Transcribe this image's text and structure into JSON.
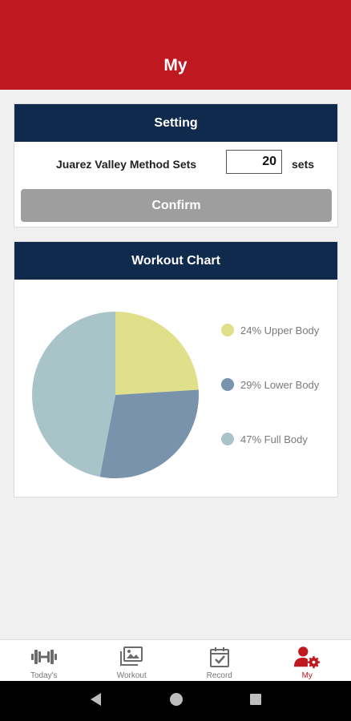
{
  "app_bar": {
    "title": "My",
    "color": "#c01820"
  },
  "setting": {
    "header": "Setting",
    "label": "Juarez Valley Method Sets",
    "value": "20",
    "unit": "sets",
    "confirm_label": "Confirm"
  },
  "workout_chart": {
    "header": "Workout Chart",
    "legend": [
      {
        "label": "24% Upper Body",
        "color": "#e0e08a"
      },
      {
        "label": "29% Lower Body",
        "color": "#7893ab"
      },
      {
        "label": "47% Full Body",
        "color": "#a9c4c9"
      }
    ]
  },
  "chart_data": {
    "type": "pie",
    "categories": [
      "Upper Body",
      "Lower Body",
      "Full Body"
    ],
    "values": [
      24,
      29,
      47
    ],
    "colors": [
      "#e0e08a",
      "#7893ab",
      "#a9c4c9"
    ],
    "start": "12 o'clock",
    "direction": "clockwise",
    "legend": "right"
  },
  "bottom_nav": {
    "items": [
      {
        "label": "Today's",
        "icon": "dumbbell-icon",
        "active": false
      },
      {
        "label": "Workout",
        "icon": "image-gallery-icon",
        "active": false
      },
      {
        "label": "Record",
        "icon": "calendar-check-icon",
        "active": false
      },
      {
        "label": "My",
        "icon": "user-settings-icon",
        "active": true
      }
    ],
    "active_color": "#c01820"
  },
  "system_nav": {
    "icons": [
      "back-icon",
      "home-icon",
      "recents-icon"
    ]
  }
}
